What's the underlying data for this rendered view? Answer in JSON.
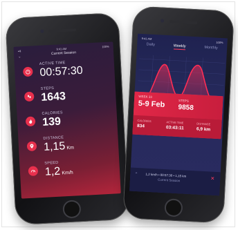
{
  "left": {
    "status": {
      "time": "9:41 AM",
      "battery": "100%",
      "signal": "••ll"
    },
    "title": "Current Session",
    "metrics": [
      {
        "label": "ACTIVE TIME",
        "value": "00:57:30",
        "unit": ""
      },
      {
        "label": "STEPS",
        "value": "1643",
        "unit": ""
      },
      {
        "label": "CALORIES",
        "value": "139",
        "unit": ""
      },
      {
        "label": "DISTANCE",
        "value": "1,15",
        "unit": "Km"
      },
      {
        "label": "SPEED",
        "value": "1,2",
        "unit": "Km/h"
      }
    ]
  },
  "right": {
    "status": {
      "time": "9:41 AM",
      "battery": "100%"
    },
    "tabs": [
      "Daily",
      "Weekly",
      "Monthly"
    ],
    "active_tab": "Weekly",
    "card": {
      "week_label": "WEEK 33",
      "dates": "5-9 Feb",
      "steps_label": "STEPS",
      "steps_value": "9858",
      "calories_label": "CALORIES",
      "calories_value": "834",
      "active_label": "ACTIVE TIME",
      "active_value": "03:43:11",
      "distance_label": "DISTANCE",
      "distance_value": "6,9 km"
    },
    "footer": {
      "summary": "1,2 km/h  •  00:57:30  •  1,15 km",
      "label": "Current Session"
    }
  },
  "colors": {
    "accent": "#e8304d",
    "bg_left": "#2a1d3d",
    "bg_right": "#1f2250"
  }
}
